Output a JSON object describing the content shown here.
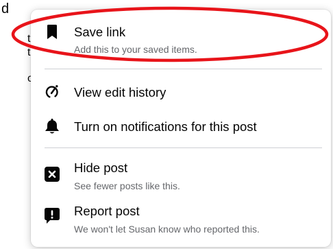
{
  "background": {
    "left_fragments": [
      "d",
      "t",
      "t",
      "c"
    ]
  },
  "menu": {
    "items": [
      {
        "icon": "bookmark-icon",
        "title": "Save link",
        "subtitle": "Add this to your saved items."
      },
      {
        "icon": "edit-history-icon",
        "title": "View edit history"
      },
      {
        "icon": "bell-icon",
        "title": "Turn on notifications for this post"
      },
      {
        "icon": "hide-icon",
        "title": "Hide post",
        "subtitle": "See fewer posts like this."
      },
      {
        "icon": "report-icon",
        "title": "Report post",
        "subtitle": "We won't let Susan know who reported this."
      }
    ]
  },
  "annotation": {
    "color": "#e8141a"
  },
  "colors": {
    "text": "#050505",
    "secondary": "#65676b",
    "divider": "#ced0d4"
  }
}
